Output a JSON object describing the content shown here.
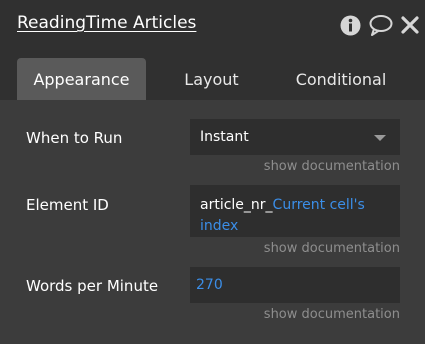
{
  "title_bar": {
    "title": "ReadingTime Articles"
  },
  "tabs": [
    {
      "label": "Appearance",
      "active": true
    },
    {
      "label": "Layout",
      "active": false
    },
    {
      "label": "Conditional",
      "active": false
    }
  ],
  "fields": {
    "when_to_run": {
      "label": "When to Run",
      "value": "Instant",
      "doc": "show documentation"
    },
    "element_id": {
      "label": "Element ID",
      "static_text": "article_nr_",
      "dynamic_line1": "Current cell's",
      "dynamic_line2": "index",
      "doc": "show documentation"
    },
    "words_per_minute": {
      "label": "Words per Minute",
      "value": "270",
      "doc": "show documentation"
    }
  },
  "colors": {
    "title_bar_bg": "#303030",
    "panel_bg": "#3c3c3c",
    "active_tab_bg": "#5a5a5a",
    "field_bg": "#2e2e2e",
    "dynamic_text": "#3b8ee8",
    "doc_link": "#8e8e8e"
  },
  "icons": [
    "info-icon",
    "comment-icon",
    "close-icon",
    "chevron-down-icon"
  ]
}
